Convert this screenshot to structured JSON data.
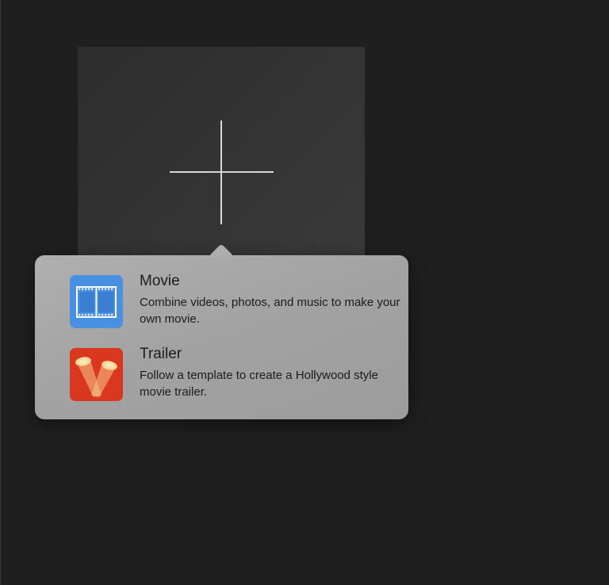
{
  "new_project": {
    "icon": "plus-icon"
  },
  "popover": {
    "options": [
      {
        "title": "Movie",
        "description": "Combine videos, photos, and music to make your own movie.",
        "icon": "film-strip-icon",
        "color": "#4a90e2"
      },
      {
        "title": "Trailer",
        "description": "Follow a template to create a Hollywood style movie trailer.",
        "icon": "spotlight-icon",
        "color": "#d9381e"
      }
    ]
  }
}
